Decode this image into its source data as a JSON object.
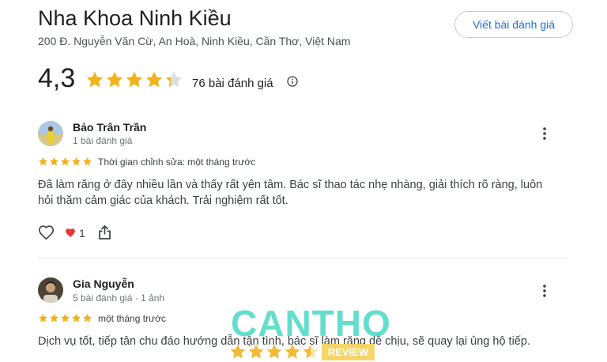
{
  "place": {
    "name": "Nha Khoa Ninh Kiều",
    "address": "200 Đ. Nguyễn Văn Cừ, An Hoà, Ninh Kiều, Cần Thơ, Việt Nam",
    "write_review_label": "Viết bài đánh giá",
    "rating": "4,3",
    "rating_value": 4.3,
    "review_count_label": "76 bài đánh giá",
    "info_icon": "info-icon"
  },
  "colors": {
    "star": "#f2b21c",
    "star_empty": "#dadce0",
    "link": "#1a73e8",
    "heart": "#e53935"
  },
  "reviews": [
    {
      "name": "Bảo Trân Trần",
      "meta": "1 bài đánh giá",
      "stars": 5,
      "time": "Thời gian chỉnh sửa: một tháng trước",
      "text": "Đã làm răng ở đây nhiều lần và thấy rất yên tâm. Bác sĩ thao tác nhẹ nhàng, giải thích rõ ràng, luôn hỏi thăm cảm giác của khách. Trải nghiệm rất tốt.",
      "reactions": {
        "heart_count": "1"
      }
    },
    {
      "name": "Gia Nguyễn",
      "meta": "5 bài đánh giá · 1 ảnh",
      "stars": 5,
      "time": "một tháng trước",
      "text": "Dịch vụ tốt, tiếp tân chu đáo hướng dẫn tận tình, bác sĩ làm răng dễ chịu, sẽ quay lại ủng hộ tiếp."
    }
  ],
  "watermark": {
    "brand": "CANTHO",
    "tag": "REVIEW",
    "stars": 4.5
  }
}
